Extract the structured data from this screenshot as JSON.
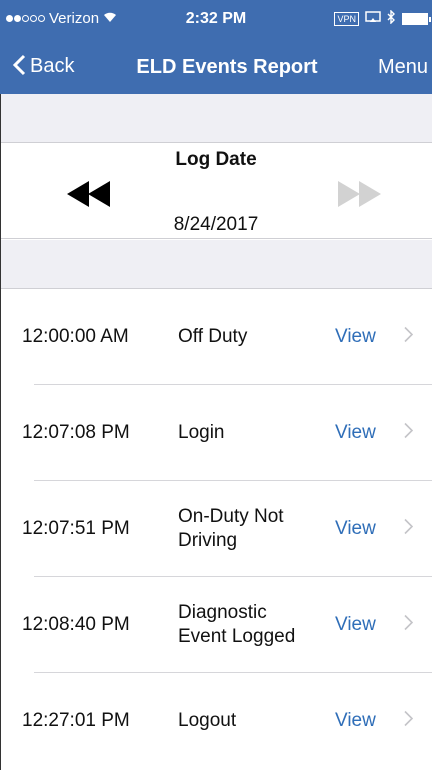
{
  "status_bar": {
    "carrier": "Verizon",
    "time": "2:32 PM",
    "vpn_label": "VPN"
  },
  "nav": {
    "back_label": "Back",
    "title": "ELD Events Report",
    "menu_label": "Menu"
  },
  "log_date": {
    "label": "Log Date",
    "value": "8/24/2017"
  },
  "events": [
    {
      "time": "12:00:00 AM",
      "event": "Off Duty",
      "action": "View"
    },
    {
      "time": "12:07:08 PM",
      "event": "Login",
      "action": "View"
    },
    {
      "time": "12:07:51 PM",
      "event": "On-Duty Not Driving",
      "action": "View"
    },
    {
      "time": "12:08:40 PM",
      "event": "Diagnostic Event Logged",
      "action": "View"
    },
    {
      "time": "12:27:01 PM",
      "event": "Logout",
      "action": "View"
    }
  ],
  "colors": {
    "nav_bg": "#3f6db0",
    "link": "#2f6eb8",
    "group_bg": "#efeff4"
  }
}
